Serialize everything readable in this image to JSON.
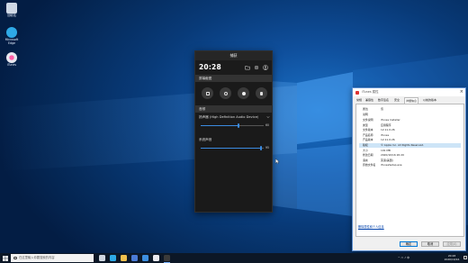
{
  "desktop": {
    "icons": [
      {
        "label": "回收站",
        "icon": "recycle-bin-icon",
        "color": "#cfd8e6"
      },
      {
        "label": "Microsoft Edge",
        "icon": "edge-icon",
        "color": "#2ea9e6"
      },
      {
        "label": "iTunes",
        "icon": "itunes-icon",
        "color": "#e8e8f0"
      }
    ]
  },
  "capture_panel": {
    "title": "捕获",
    "time": "20:28",
    "capture_section": "屏幕截图",
    "audio_section": "音频",
    "device_label": "扬声器 (High Definition Audio Device)",
    "device_value": "60",
    "system_label": "系统声音",
    "system_value": "95",
    "device_level": 0.6,
    "system_level": 0.95,
    "accent": "#3b8be0"
  },
  "properties_dialog": {
    "title": "iTunes 属性",
    "tabs": [
      "常规",
      "兼容性",
      "数字签名",
      "安全",
      "详细信息",
      "以前的版本"
    ],
    "active_tab": 4,
    "columns": {
      "property": "属性",
      "value": "值"
    },
    "section": "说明",
    "rows": [
      {
        "k": "文件说明",
        "v": "iTunes Installer"
      },
      {
        "k": "类型",
        "v": "应用程序"
      },
      {
        "k": "文件版本",
        "v": "12.11.0.26"
      },
      {
        "k": "产品名称",
        "v": "iTunes"
      },
      {
        "k": "产品版本",
        "v": "12.11.0.26"
      },
      {
        "k": "版权",
        "v": "© Apple Inc. All Rights Reserved."
      },
      {
        "k": "大小",
        "v": "191 MB"
      },
      {
        "k": "修改日期",
        "v": "2020/10/16 20:20"
      },
      {
        "k": "语言",
        "v": "英语(美国)"
      },
      {
        "k": "原始文件名",
        "v": "iTunesSetup.exe"
      }
    ],
    "selected_row": 5,
    "link": "删除属性和个人信息",
    "buttons": {
      "ok": "确定",
      "cancel": "取消",
      "apply": "应用(A)"
    }
  },
  "taskbar": {
    "search_placeholder": "在这里输入你要搜索的内容",
    "apps": [
      {
        "name": "task-view-icon",
        "color": "#cfd6e0"
      },
      {
        "name": "edge-icon",
        "color": "#2ea9e6"
      },
      {
        "name": "file-explorer-icon",
        "color": "#f2c14e"
      },
      {
        "name": "store-icon",
        "color": "#4a7bd6"
      },
      {
        "name": "mail-icon",
        "color": "#3d8fe0"
      },
      {
        "name": "itunes-icon",
        "color": "#e9e9ef"
      },
      {
        "name": "game-bar-icon",
        "color": "#3a3a3a"
      }
    ],
    "tray_text": "^  ▭  ♪  中",
    "time": "20:28",
    "date": "2020/10/16"
  }
}
